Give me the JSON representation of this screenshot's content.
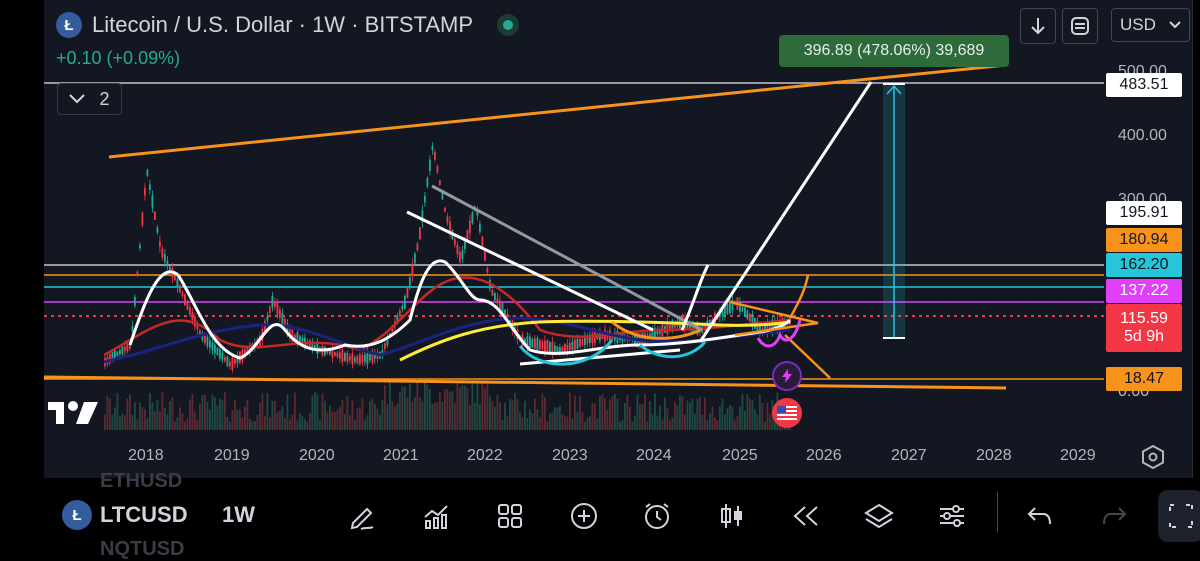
{
  "header": {
    "coin_letter": "Ł",
    "title": "Litecoin / U.S. Dollar · 1W · BITSTAMP",
    "change": "+0.10 (+0.09%)"
  },
  "indicators": {
    "collapse_count": "2"
  },
  "toolbar_top": {
    "currency": "USD"
  },
  "measure": {
    "label": "396.89 (478.06%) 39,689"
  },
  "price_axis": {
    "labels": [
      "500.00",
      "400.00",
      "300.00",
      "0.00"
    ],
    "tags": [
      {
        "text": "483.51",
        "bg": "#ffffff",
        "fg": "#131722"
      },
      {
        "text": "195.91",
        "bg": "#ffffff",
        "fg": "#131722"
      },
      {
        "text": "180.94",
        "bg": "#f7931a",
        "fg": "#131722"
      },
      {
        "text": "162.20",
        "bg": "#26c6da",
        "fg": "#131722"
      },
      {
        "text": "137.22",
        "bg": "#e040fb",
        "fg": "#ffffff"
      },
      {
        "text": "115.59",
        "sub": "5d 9h",
        "bg": "#f23645",
        "fg": "#ffffff"
      },
      {
        "text": "18.47",
        "bg": "#f7931a",
        "fg": "#131722"
      }
    ]
  },
  "time_axis": [
    "2018",
    "2019",
    "2020",
    "2021",
    "2022",
    "2023",
    "2024",
    "2025",
    "2026",
    "2027",
    "2028",
    "2029"
  ],
  "bottom": {
    "ghost_top": "ETHUSD",
    "ghost_bottom": "NQTUSD",
    "symbol": "LTCUSD",
    "interval": "1W"
  },
  "colors": {
    "bg": "#131722",
    "orange": "#f7931a",
    "teal": "#26c6da",
    "magenta": "#e040fb",
    "red": "#f23645",
    "green": "#22ab94"
  }
}
